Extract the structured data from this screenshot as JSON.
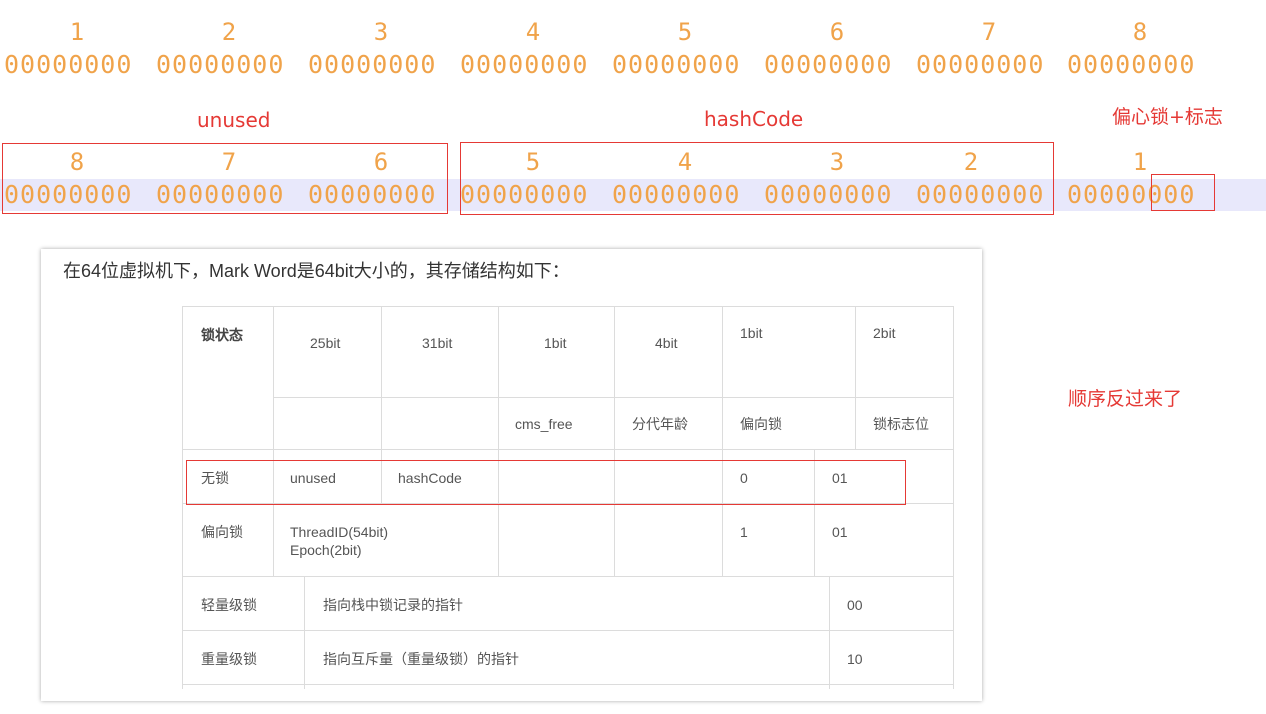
{
  "top_indices": [
    "1",
    "2",
    "3",
    "4",
    "5",
    "6",
    "7",
    "8"
  ],
  "byte_pattern": "00000000",
  "labels": {
    "unused": "unused",
    "hashcode": "hashCode",
    "biased_flag": "偏心锁+标志",
    "reversed_note": "顺序反过来了"
  },
  "bottom_indices": [
    "8",
    "7",
    "6",
    "5",
    "4",
    "3",
    "2",
    "1"
  ],
  "table": {
    "intro": "在64位虚拟机下，Mark Word是64bit大小的，其存储结构如下：",
    "header_state": "锁状态",
    "widths": [
      "25bit",
      "31bit",
      "1bit",
      "4bit",
      "1bit",
      "2bit"
    ],
    "subheaders": [
      "cms_free",
      "分代年龄",
      "偏向锁",
      "锁标志位"
    ],
    "rows": {
      "unlocked": {
        "state": "无锁",
        "c1": "unused",
        "c2": "hashCode",
        "biased": "0",
        "flag": "01"
      },
      "biased": {
        "state": "偏向锁",
        "thread": "ThreadID(54bit)",
        "epoch": "Epoch(2bit)",
        "biased": "1",
        "flag": "01"
      },
      "light": {
        "state": "轻量级锁",
        "desc": "指向栈中锁记录的指针",
        "flag": "00"
      },
      "heavy": {
        "state": "重量级锁",
        "desc": "指向互斥量（重量级锁）的指针",
        "flag": "10"
      }
    }
  }
}
